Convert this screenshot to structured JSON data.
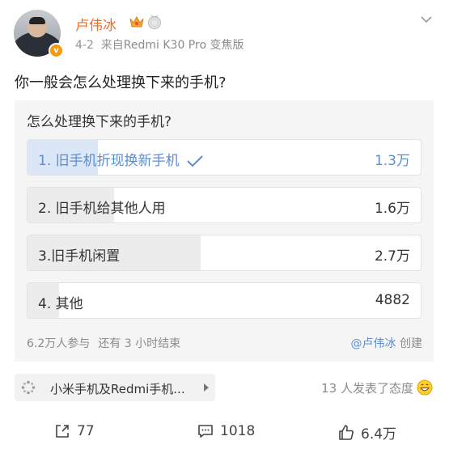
{
  "header": {
    "username": "卢伟冰",
    "date": "4-2",
    "source_prefix": "来自",
    "source_device": "Redmi K30 Pro 变焦版",
    "verified_badge": "v"
  },
  "post": {
    "text": "你一般会怎么处理换下来的手机?"
  },
  "poll": {
    "title": "怎么处理换下来的手机?",
    "options": [
      {
        "label": "1. 旧手机折现换新手机",
        "count": "1.3万",
        "fraction": 0.18,
        "selected": true
      },
      {
        "label": "2. 旧手机给其他人用",
        "count": "1.6万",
        "fraction": 0.22,
        "selected": false
      },
      {
        "label": "3.旧手机闲置",
        "count": "2.7万",
        "fraction": 0.44,
        "selected": false
      },
      {
        "label": "4. 其他",
        "count": "4882",
        "fraction": 0.08,
        "selected": false
      }
    ],
    "participants": "6.2万人参与",
    "remaining": "还有 3 小时结束",
    "creator_name": "@卢伟冰",
    "creator_suffix": "创建"
  },
  "topic": {
    "label": "小米手机及Redmi手机..."
  },
  "reactions": {
    "text": "13 人发表了态度"
  },
  "actions": {
    "share": "77",
    "comment": "1018",
    "like": "6.4万"
  },
  "colors": {
    "username": "#f26a28",
    "accent": "#5a8ed3",
    "badge": "#f59a0b"
  },
  "icons": [
    "crown-icon",
    "medal-icon",
    "chevron-down-icon",
    "check-icon",
    "spinner-icon",
    "grin-emoji-icon",
    "share-icon",
    "comment-icon",
    "like-icon"
  ]
}
